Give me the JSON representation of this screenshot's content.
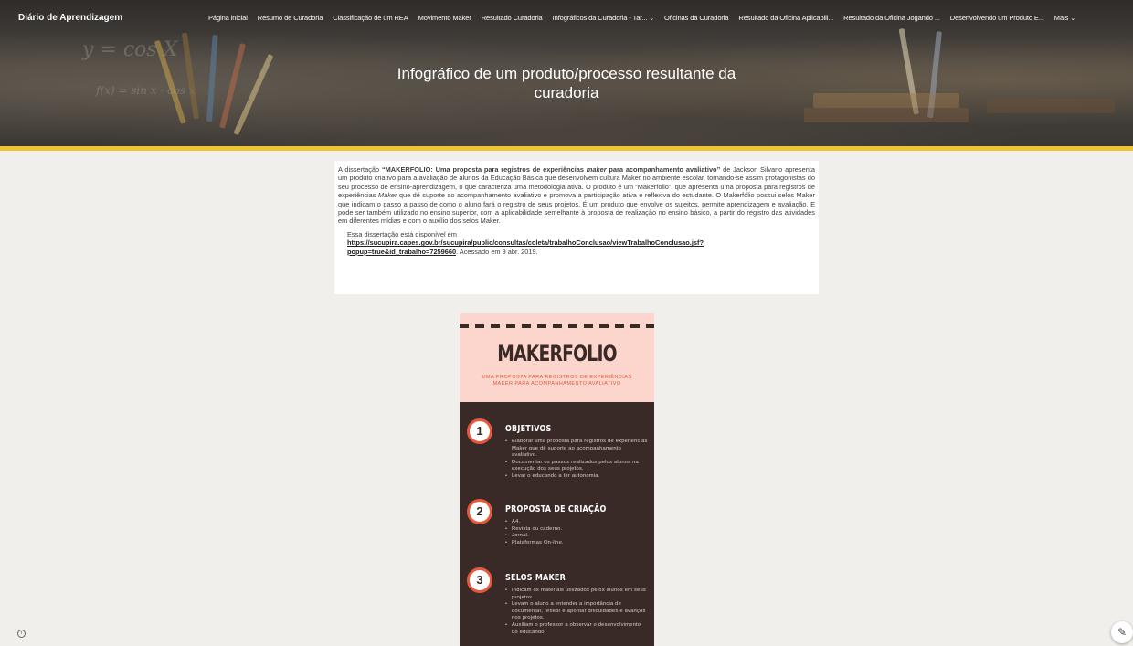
{
  "site": {
    "title": "Diário de Aprendizagem"
  },
  "nav": {
    "items": [
      {
        "label": "Página inicial"
      },
      {
        "label": "Resumo de Curadoria"
      },
      {
        "label": "Classificação de um REA"
      },
      {
        "label": "Movimento Maker"
      },
      {
        "label": "Resultado Curadoria"
      },
      {
        "label": "Infográficos da Curadoria - Tar..."
      },
      {
        "label": "Oficinas da Curadoria"
      },
      {
        "label": "Resultado da Oficina Aplicabili..."
      },
      {
        "label": "Resultado da Oficina Jogando ..."
      },
      {
        "label": "Desenvolvendo um Produto E..."
      },
      {
        "label": "Mais"
      }
    ]
  },
  "banner": {
    "heading_line1": "Infográfico de um produto/processo resultante da",
    "heading_line2": "curadoria",
    "formula": "y = cos X",
    "formula2": "f(x) = sin x · cos x"
  },
  "content": {
    "intro_prefix": "A dissertação ",
    "intro_title": "“MAKERFOLIO: Uma proposta para registros de experiências ",
    "intro_title_italic": "maker",
    "intro_title_end": " para acompanhamento avaliativo”",
    "intro_body": " de Jackson Silvano apresenta um produto criativo para a avaliação de alunos da Educação Básica que desenvolvem cultura Maker no ambiente escolar, tornando-se assim protagonistas do seu processo de ensino-aprendizagem, o que caracteriza uma metodologia ativa. O produto é um “Makerfolio”, que apresenta uma proposta para registros de experiências ",
    "intro_body_italic": "Maker",
    "intro_body_end": " que dê suporte ao acompanhamento avaliativo e promova a participação ativa e reflexiva do estudante. O Makerfólio possui selos Maker que indicam o passo a passo de como o aluno fará o registro de seus projetos. É um produto que envolve os sujeitos, permite aprendizagem e avaliação. E pode ser também utilizado no ensino superior, com a aplicabilidade semelhante à proposta de realização no ensino básico, a partir do registro das atividades em diferentes mídias e com o auxílio dos selos Maker.",
    "available_prefix": "Essa dissertação está disponível em",
    "link_line1": "https://sucupira.capes.gov.br/sucupira/public/consultas/coleta/trabalhoConclusao/viewTrabalhoConclusao.jsf?",
    "link_line2": "popup=true&id_trabalho=7259660",
    "accessed": ". Acessado em 9 abr. 2019."
  },
  "infographic": {
    "title": "MAKERFOLIO",
    "subtitle": "UMA PROPOSTA PARA REGISTROS DE EXPERIÊNCIAS MAKER PARA ACOMPANHAMENTO AVALIATIVO",
    "sections": [
      {
        "number": "1",
        "title": "OBJETIVOS",
        "bullets": [
          "Elaborar uma proposta para registros de experiências Maker que dê suporte ao acompanhamento avaliativo.",
          "Documentar os passos realizados pelos alunos na execução dos seus projetos.",
          "Levar o educando a ter autonomia."
        ]
      },
      {
        "number": "2",
        "title": "PROPOSTA DE CRIAÇÃO",
        "bullets": [
          "A4.",
          "Revista ou caderno.",
          "Jornal.",
          "Plataformas On-line."
        ]
      },
      {
        "number": "3",
        "title": "SELOS MAKER",
        "bullets": [
          "Indicam os materiais utilizados pelos alunos em seus projetos.",
          "Levam o aluno a entender a importância de documentar, refletir e apontar dificuldades e avanços nos projetos.",
          "Auxiliam o professor a observar o desenvolvimento do educando."
        ]
      }
    ]
  },
  "controls": {
    "info_icon": "info-icon",
    "edit_icon": "pencil-icon"
  },
  "colors": {
    "accent": "#f1c232",
    "info_bg": "#3a2a27",
    "info_top": "#fcd6cc",
    "orange": "#e8573c"
  }
}
